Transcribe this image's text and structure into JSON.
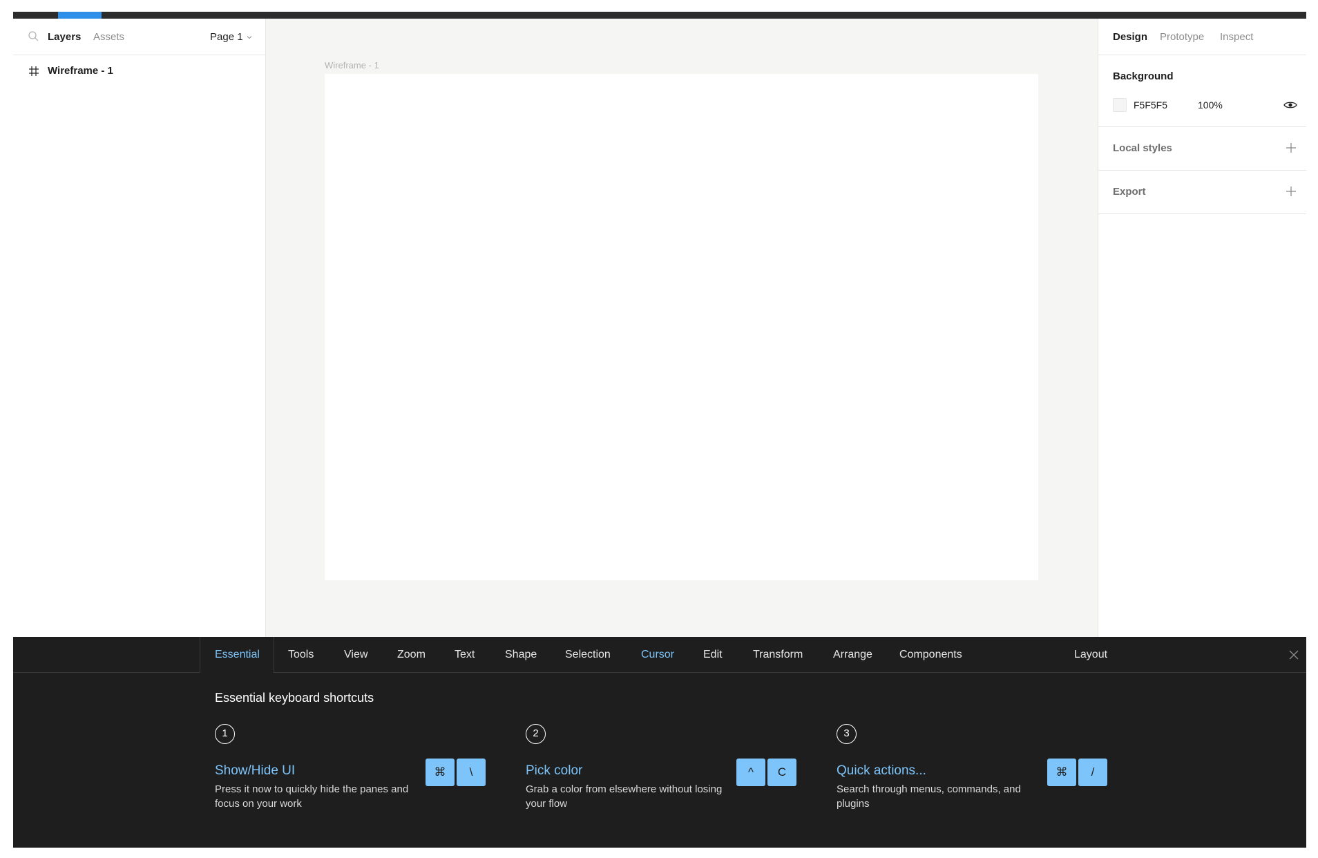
{
  "left_panel": {
    "tabs": {
      "layers": "Layers",
      "assets": "Assets"
    },
    "page_selector": "Page 1",
    "layers": [
      {
        "name": "Wireframe - 1"
      }
    ]
  },
  "canvas": {
    "frame_label": "Wireframe - 1",
    "background_color": "#f5f5f4"
  },
  "right_panel": {
    "tabs": {
      "design": "Design",
      "prototype": "Prototype",
      "inspect": "Inspect"
    },
    "background": {
      "title": "Background",
      "hex": "F5F5F5",
      "opacity": "100%"
    },
    "local_styles": {
      "title": "Local styles"
    },
    "export": {
      "title": "Export"
    }
  },
  "shortcuts": {
    "tabs": [
      "Essential",
      "Tools",
      "View",
      "Zoom",
      "Text",
      "Shape",
      "Selection",
      "Cursor",
      "Edit",
      "Transform",
      "Arrange",
      "Components",
      "Layout"
    ],
    "active_tab": "Essential",
    "title": "Essential keyboard shortcuts",
    "items": [
      {
        "number": "1",
        "title": "Show/Hide UI",
        "desc": "Press it now to quickly hide the panes and focus on your work",
        "keys": [
          "⌘",
          "\\"
        ]
      },
      {
        "number": "2",
        "title": "Pick color",
        "desc": "Grab a color from elsewhere without losing your flow",
        "keys": [
          "^",
          "C"
        ]
      },
      {
        "number": "3",
        "title": "Quick actions...",
        "desc": "Search through menus, commands, and plugins",
        "keys": [
          "⌘",
          "/"
        ]
      }
    ]
  },
  "colors": {
    "accent": "#2f8ee8",
    "highlight": "#7cc4fa",
    "panel_dark": "#1e1e1e"
  }
}
